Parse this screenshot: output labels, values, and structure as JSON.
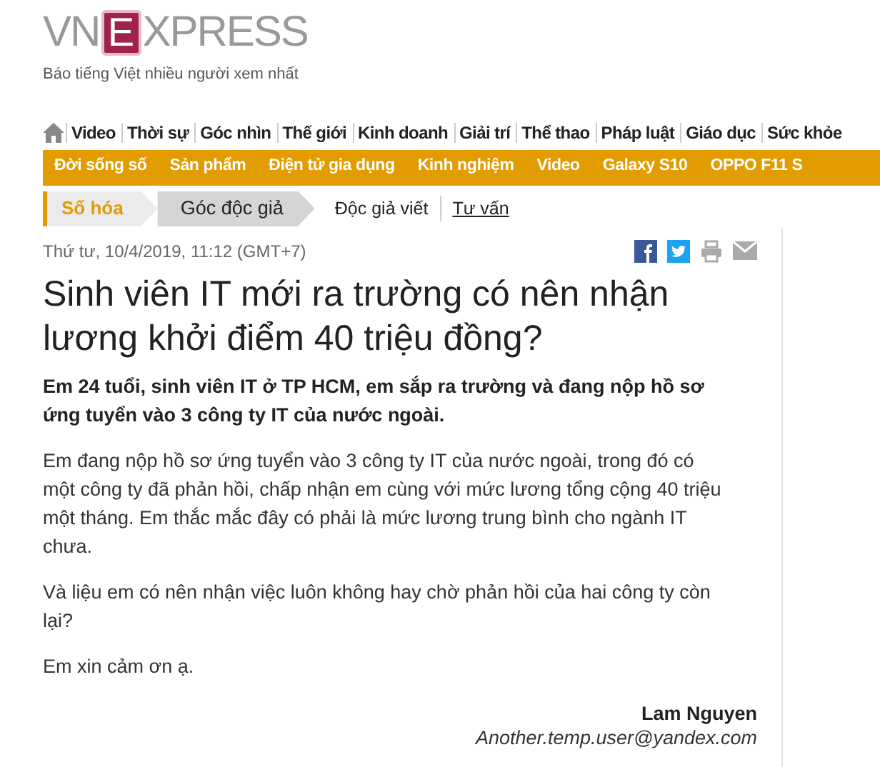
{
  "logo": {
    "left": "VN",
    "boxed": "E",
    "right": "XPRESS"
  },
  "tagline": "Báo tiếng Việt nhiều người xem nhất",
  "main_nav": [
    "Video",
    "Thời sự",
    "Góc nhìn",
    "Thế giới",
    "Kinh doanh",
    "Giải trí",
    "Thể thao",
    "Pháp luật",
    "Giáo dục",
    "Sức khỏe"
  ],
  "sub_nav": [
    "Đời sống số",
    "Sản phẩm",
    "Điện tử gia dụng",
    "Kinh nghiệm",
    "Video",
    "Galaxy S10",
    "OPPO F11 S"
  ],
  "breadcrumb": [
    {
      "label": "Số hóa",
      "kind": "section"
    },
    {
      "label": "Góc độc giả",
      "kind": "subsection"
    }
  ],
  "breadcrumb_links": [
    {
      "label": "Độc giả viết",
      "selected": false
    },
    {
      "label": "Tư vấn",
      "selected": true
    }
  ],
  "date": "Thứ tư, 10/4/2019, 11:12 (GMT+7)",
  "title": "Sinh viên IT mới ra trường có nên nhận lương khởi điểm 40 triệu đồng?",
  "lead": "Em 24 tuổi, sinh viên IT ở TP HCM, em sắp ra trường và đang nộp hồ sơ ứng tuyển vào 3 công ty IT của nước ngoài.",
  "paragraphs": [
    "Em đang nộp hồ sơ ứng tuyển vào 3 công ty IT của nước ngoài, trong đó có một công ty đã phản hồi, chấp nhận em cùng với mức lương tổng cộng 40 triệu một tháng. Em thắc mắc đây có phải là mức lương trung bình cho ngành IT chưa.",
    "Và liệu em có nên nhận việc luôn không hay chờ phản hồi của hai công ty còn lại?",
    "Em xin cảm ơn ạ."
  ],
  "author": "Lam Nguyen",
  "email": "Another.temp.user@yandex.com"
}
